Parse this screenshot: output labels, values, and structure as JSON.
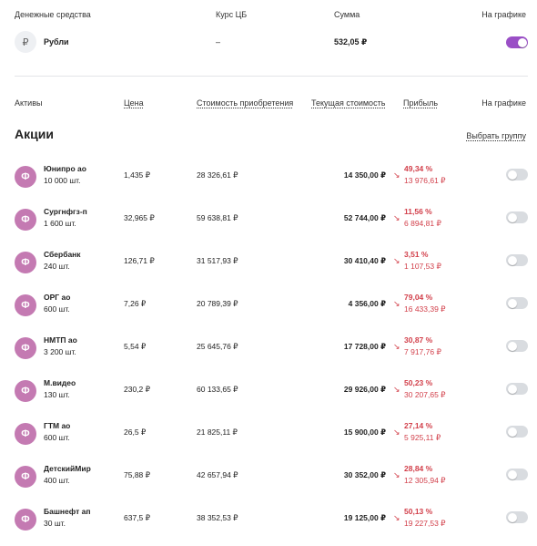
{
  "cash_header": {
    "col_funds": "Денежные средства",
    "col_rate": "Курс ЦБ",
    "col_sum": "Сумма",
    "col_chart": "На графике"
  },
  "cash_row": {
    "icon": "₽",
    "name": "Рубли",
    "rate": "–",
    "sum": "532,05 ₽",
    "on_chart": true
  },
  "assets_header": {
    "col_assets": "Активы",
    "col_price": "Цена",
    "col_cost": "Стоимость приобретения",
    "col_current": "Текущая стоимость",
    "col_profit": "Прибыль",
    "col_chart": "На графике"
  },
  "section": {
    "title": "Акции",
    "select_group": "Выбрать группу"
  },
  "avatar_letter": "Ф",
  "rows": [
    {
      "name": "Юнипро ао",
      "qty": "10 000 шт.",
      "price": "1,435 ₽",
      "cost": "28 326,61 ₽",
      "current": "14 350,00 ₽",
      "pct": "49,34 %",
      "amount": "13 976,61 ₽"
    },
    {
      "name": "Сургнфгз-п",
      "qty": "1 600 шт.",
      "price": "32,965 ₽",
      "cost": "59 638,81 ₽",
      "current": "52 744,00 ₽",
      "pct": "11,56 %",
      "amount": "6 894,81 ₽"
    },
    {
      "name": "Сбербанк",
      "qty": "240 шт.",
      "price": "126,71 ₽",
      "cost": "31 517,93 ₽",
      "current": "30 410,40 ₽",
      "pct": "3,51 %",
      "amount": "1 107,53 ₽"
    },
    {
      "name": "ОРГ ао",
      "qty": "600 шт.",
      "price": "7,26 ₽",
      "cost": "20 789,39 ₽",
      "current": "4 356,00 ₽",
      "pct": "79,04 %",
      "amount": "16 433,39 ₽"
    },
    {
      "name": "НМТП ао",
      "qty": "3 200 шт.",
      "price": "5,54 ₽",
      "cost": "25 645,76 ₽",
      "current": "17 728,00 ₽",
      "pct": "30,87 %",
      "amount": "7 917,76 ₽"
    },
    {
      "name": "М.видео",
      "qty": "130 шт.",
      "price": "230,2 ₽",
      "cost": "60 133,65 ₽",
      "current": "29 926,00 ₽",
      "pct": "50,23 %",
      "amount": "30 207,65 ₽"
    },
    {
      "name": "ГТМ ао",
      "qty": "600 шт.",
      "price": "26,5 ₽",
      "cost": "21 825,11 ₽",
      "current": "15 900,00 ₽",
      "pct": "27,14 %",
      "amount": "5 925,11 ₽"
    },
    {
      "name": "ДетскийМир",
      "qty": "400 шт.",
      "price": "75,88 ₽",
      "cost": "42 657,94 ₽",
      "current": "30 352,00 ₽",
      "pct": "28,84 %",
      "amount": "12 305,94 ₽"
    },
    {
      "name": "Башнефт ап",
      "qty": "30 шт.",
      "price": "637,5 ₽",
      "cost": "38 352,53 ₽",
      "current": "19 125,00 ₽",
      "pct": "50,13 %",
      "amount": "19 227,53 ₽"
    }
  ],
  "icons": {
    "rub": "ruble-icon",
    "avatar": "fund-avatar-icon",
    "loss": "arrow-down-right-icon"
  },
  "colors": {
    "accent": "#9a4fc6",
    "avatar": "#c47ab2",
    "loss": "#d23f4a"
  }
}
